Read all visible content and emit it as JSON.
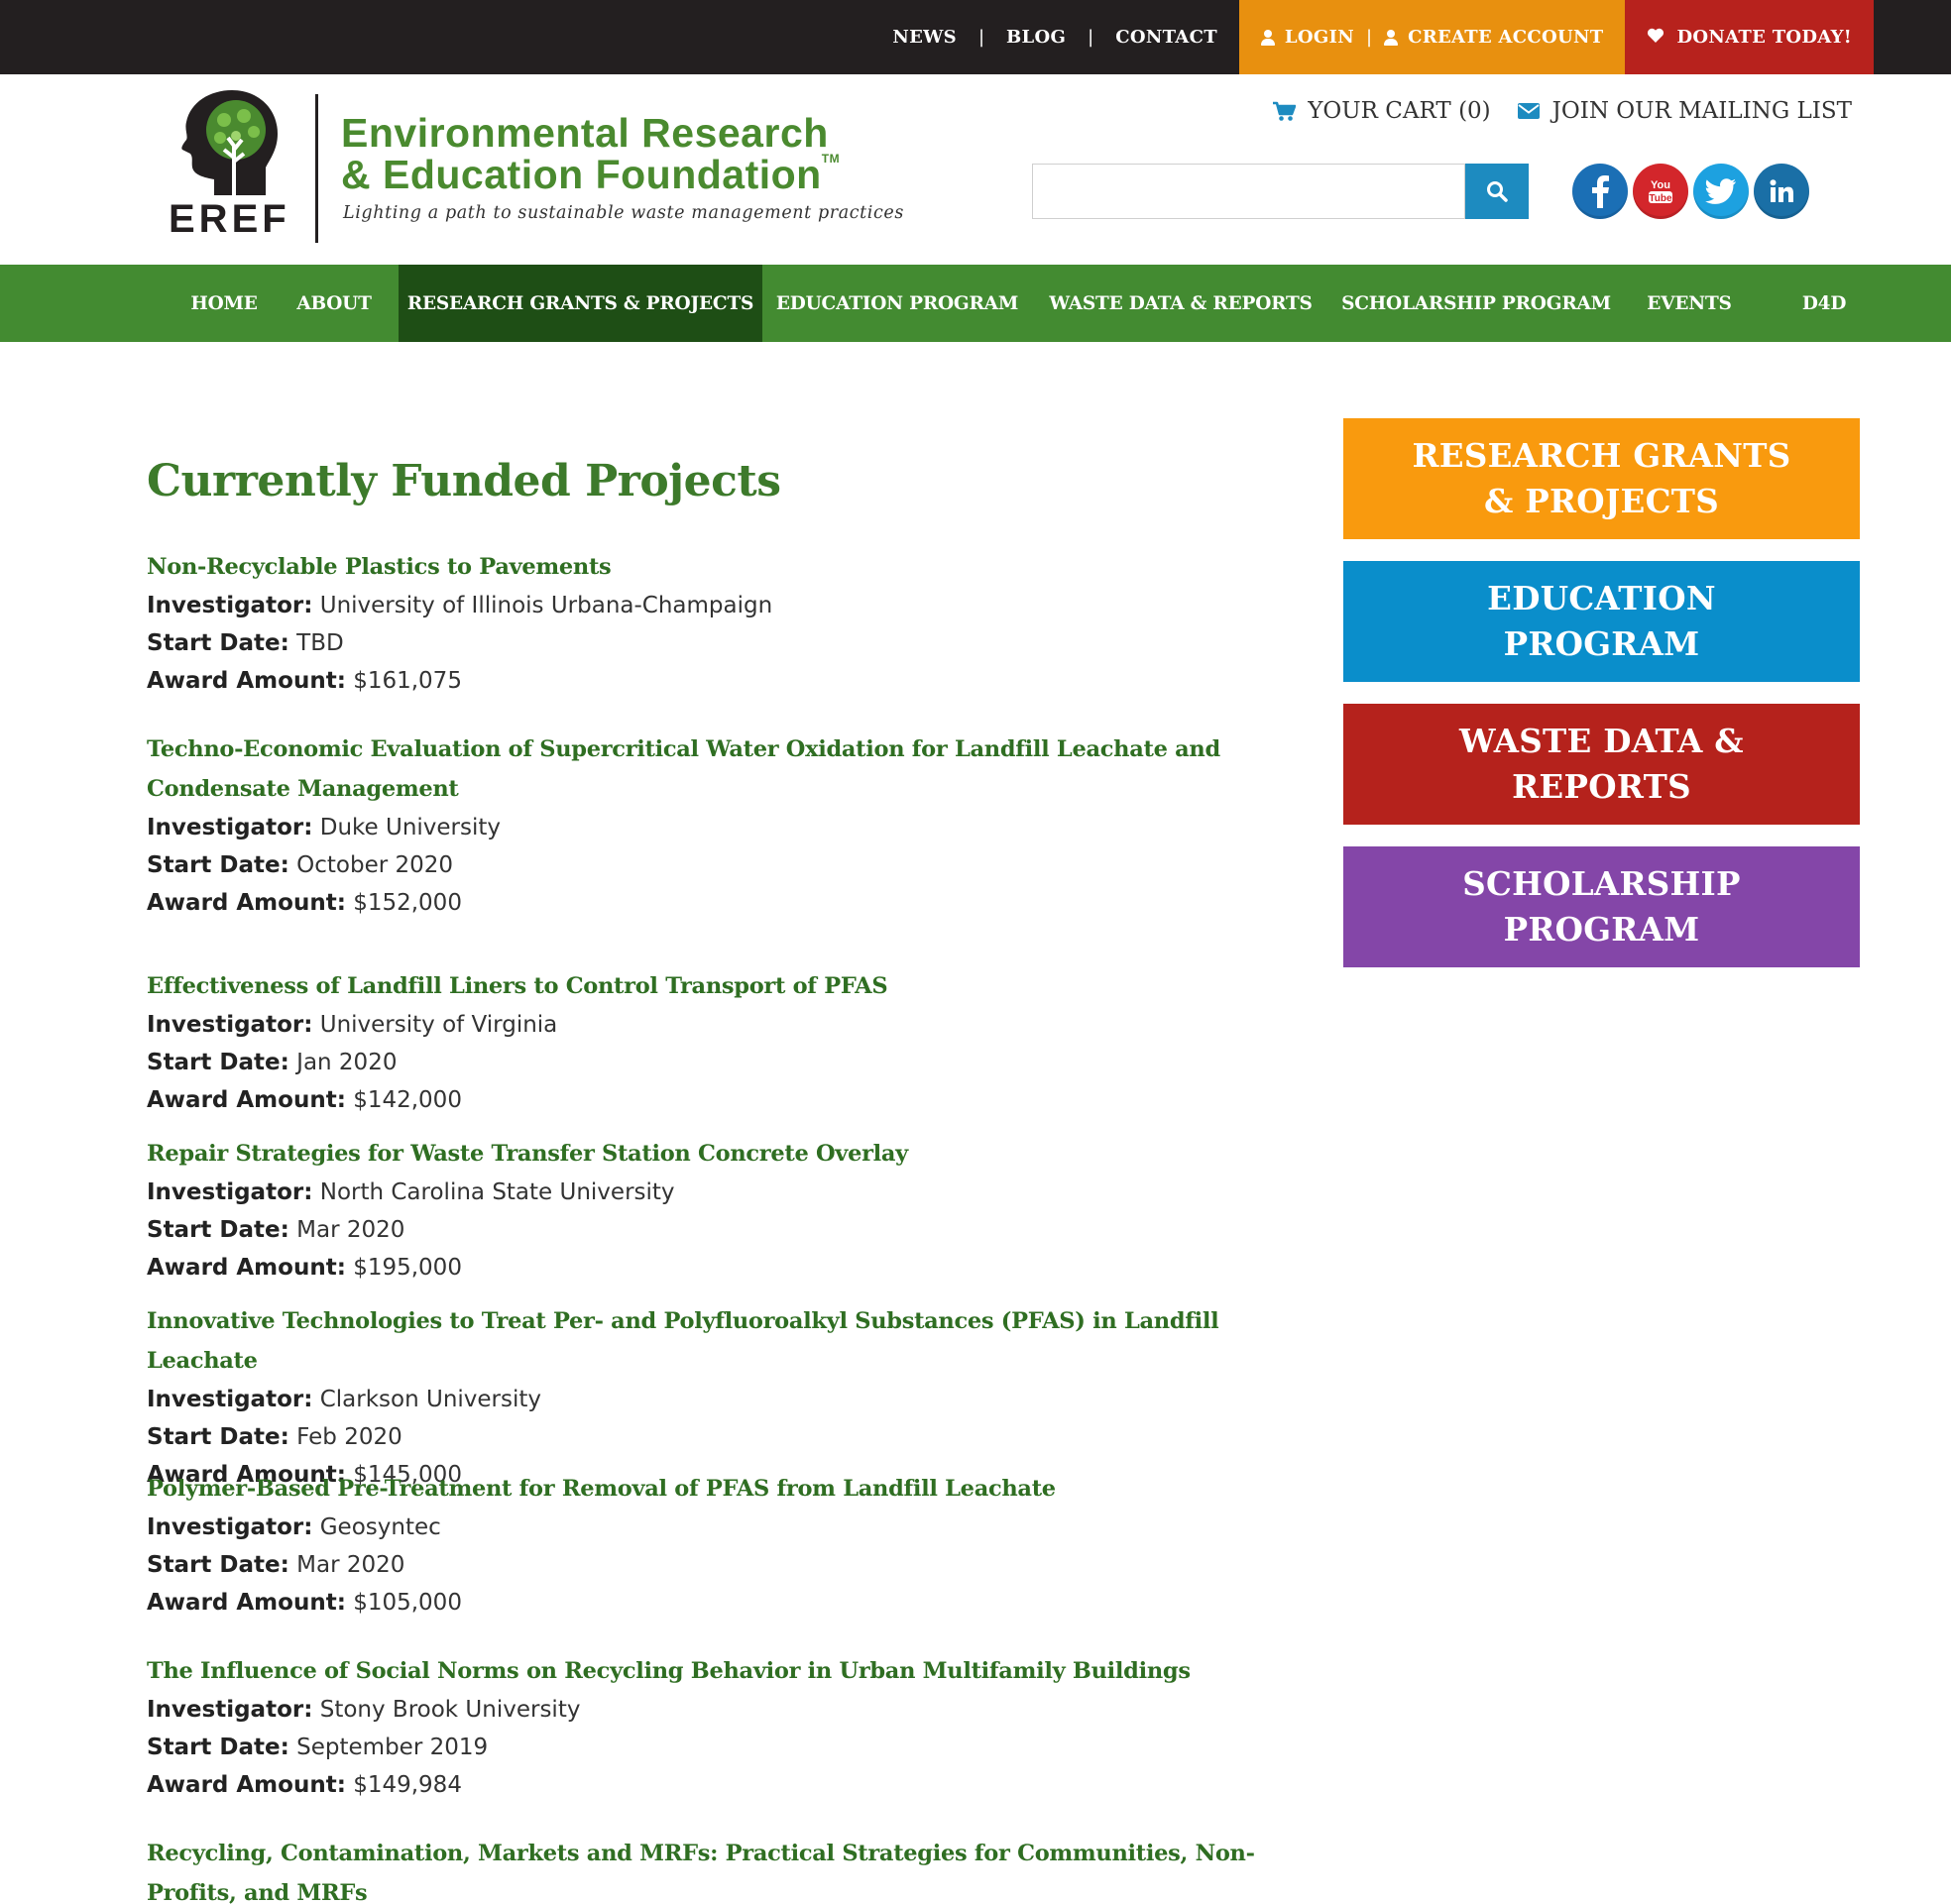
{
  "topbar": {
    "news": "NEWS",
    "blog": "BLOG",
    "contact": "CONTACT",
    "separator": "|",
    "login": "LOGIN",
    "create_account": "CREATE ACCOUNT",
    "donate": "DONATE TODAY!",
    "colors": {
      "bar": "#231f20",
      "account": "#e8900f",
      "donate": "#b7221d"
    }
  },
  "header": {
    "logo_mark": "EREF",
    "logo_title_line1": "Environmental Research",
    "logo_title_line2": "& Education Foundation",
    "logo_tm": "TM",
    "logo_tagline": "Lighting a path to sustainable waste management practices",
    "cart": "YOUR CART (0)",
    "mailing_list": "JOIN OUR MAILING LIST",
    "search": {
      "value": "",
      "placeholder": ""
    },
    "socials": [
      {
        "icon": "facebook-icon",
        "color": "#1b6fb5"
      },
      {
        "icon": "youtube-icon",
        "color": "#d3262b"
      },
      {
        "icon": "twitter-icon",
        "color": "#1da1e0"
      },
      {
        "icon": "linkedin-icon",
        "color": "#1a6fa6"
      }
    ]
  },
  "nav": {
    "items": [
      "HOME",
      "ABOUT",
      "RESEARCH GRANTS & PROJECTS",
      "EDUCATION PROGRAM",
      "WASTE DATA & REPORTS",
      "SCHOLARSHIP PROGRAM",
      "EVENTS",
      "D4D"
    ],
    "active": "RESEARCH GRANTS & PROJECTS",
    "color": "#438b31",
    "active_color": "#1e4e15"
  },
  "main": {
    "title": "Currently Funded Projects",
    "labels": {
      "investigator": "Investigator:",
      "start_date": "Start Date:",
      "award_amount": "Award Amount:"
    },
    "projects": [
      {
        "title": "Non-Recyclable Plastics to Pavements",
        "investigator": "University of Illinois Urbana-Champaign",
        "start_date": "TBD",
        "award_amount": "$161,075"
      },
      {
        "title": "Techno-Economic Evaluation of Supercritical Water Oxidation for Landfill Leachate and Condensate Management",
        "investigator": "Duke University",
        "start_date": "October 2020",
        "award_amount": "$152,000"
      },
      {
        "title": "Effectiveness of Landfill Liners to Control Transport of PFAS",
        "investigator": "University of Virginia",
        "start_date": "Jan 2020",
        "award_amount": "$142,000"
      },
      {
        "title": "Repair Strategies for Waste Transfer Station Concrete Overlay",
        "investigator": "North Carolina State University",
        "start_date": "Mar 2020",
        "award_amount": "$195,000"
      },
      {
        "title": "Innovative Technologies to Treat Per- and Polyfluoroalkyl Substances (PFAS) in Landfill Leachate",
        "investigator": "Clarkson University",
        "start_date": "Feb 2020",
        "award_amount": "$145,000"
      },
      {
        "title": "Polymer-Based Pre-Treatment for Removal of PFAS from Landfill Leachate",
        "investigator": "Geosyntec",
        "start_date": "Mar 2020",
        "award_amount": "$105,000"
      },
      {
        "title": "The Influence of Social Norms on Recycling Behavior in Urban Multifamily Buildings",
        "investigator": "Stony Brook University",
        "start_date": "September 2019",
        "award_amount": "$149,984"
      },
      {
        "title": "Recycling, Contamination, Markets and MRFs: Practical Strategies for Communities, Non-Profits, and MRFs"
      }
    ]
  },
  "sidebar": {
    "buttons": [
      {
        "label": "RESEARCH GRANTS & PROJECTS",
        "color": "#f99a0e"
      },
      {
        "label": "EDUCATION PROGRAM",
        "color": "#0a8ecb"
      },
      {
        "label": "WASTE DATA & REPORTS",
        "color": "#b5221c"
      },
      {
        "label": "SCHOLARSHIP PROGRAM",
        "color": "#8446a8"
      }
    ]
  }
}
